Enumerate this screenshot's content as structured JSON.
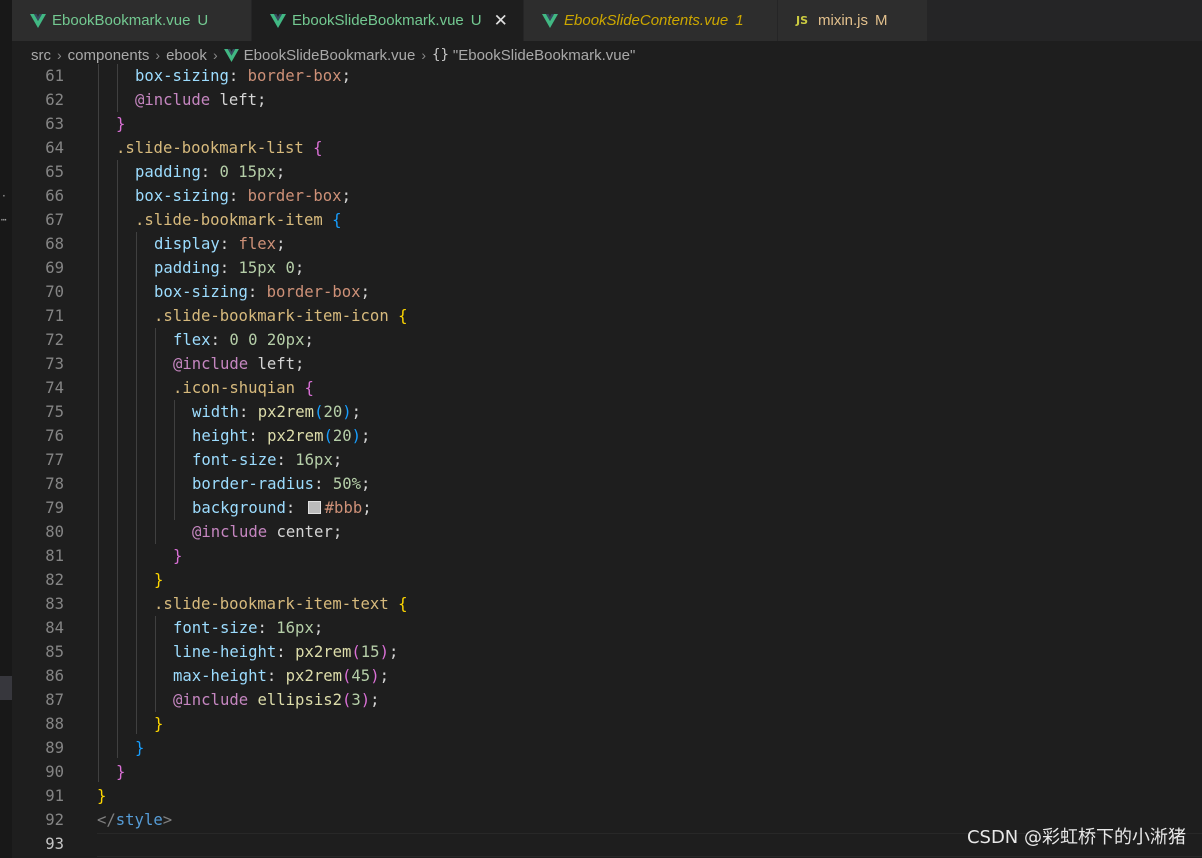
{
  "tabs": [
    {
      "name": "EbookBookmark.vue",
      "badge": "U",
      "icon": "vue-icon",
      "active": false,
      "italic": false,
      "color": "#73c991"
    },
    {
      "name": "EbookSlideBookmark.vue",
      "badge": "U",
      "icon": "vue-icon",
      "active": true,
      "italic": false,
      "color": "#73c991",
      "close": "✕"
    },
    {
      "name": "EbookSlideContents.vue",
      "badge": "1",
      "icon": "vue-icon",
      "active": false,
      "italic": true,
      "color": "#cca700"
    },
    {
      "name": "mixin.js",
      "badge": "M",
      "icon": "js-icon",
      "icon_text": "JS",
      "active": false,
      "italic": false,
      "color": "#e2c08d"
    }
  ],
  "breadcrumb": {
    "items": [
      "src",
      "components",
      "ebook",
      "EbookSlideBookmark.vue",
      "\"EbookSlideBookmark.vue\""
    ],
    "separator": "›",
    "symbol_icon": "{}"
  },
  "editor": {
    "current_line": "93",
    "lines": [
      {
        "n": "61",
        "indent": 2
      },
      {
        "n": "62",
        "indent": 2
      },
      {
        "n": "63",
        "indent": 1
      },
      {
        "n": "64",
        "indent": 1
      },
      {
        "n": "65",
        "indent": 2
      },
      {
        "n": "66",
        "indent": 2
      },
      {
        "n": "67",
        "indent": 2
      },
      {
        "n": "68",
        "indent": 3
      },
      {
        "n": "69",
        "indent": 3
      },
      {
        "n": "70",
        "indent": 3
      },
      {
        "n": "71",
        "indent": 3
      },
      {
        "n": "72",
        "indent": 4
      },
      {
        "n": "73",
        "indent": 4
      },
      {
        "n": "74",
        "indent": 4
      },
      {
        "n": "75",
        "indent": 5
      },
      {
        "n": "76",
        "indent": 5
      },
      {
        "n": "77",
        "indent": 5
      },
      {
        "n": "78",
        "indent": 5
      },
      {
        "n": "79",
        "indent": 5
      },
      {
        "n": "80",
        "indent": 5
      },
      {
        "n": "81",
        "indent": 4
      },
      {
        "n": "82",
        "indent": 3
      },
      {
        "n": "83",
        "indent": 3
      },
      {
        "n": "84",
        "indent": 4
      },
      {
        "n": "85",
        "indent": 4
      },
      {
        "n": "86",
        "indent": 4
      },
      {
        "n": "87",
        "indent": 4
      },
      {
        "n": "88",
        "indent": 3
      },
      {
        "n": "89",
        "indent": 2
      },
      {
        "n": "90",
        "indent": 1
      },
      {
        "n": "91",
        "indent": 0
      },
      {
        "n": "92",
        "indent": 0
      },
      {
        "n": "93",
        "indent": 0
      }
    ],
    "code": {
      "l61": [
        "box-sizing",
        ": ",
        "border-box",
        ";"
      ],
      "l62": [
        "@include",
        " left;"
      ],
      "l63": [
        "}"
      ],
      "l64": [
        ".slide-bookmark-list",
        " ",
        "{"
      ],
      "l65": [
        "padding",
        ": ",
        "0",
        " ",
        "15px",
        ";"
      ],
      "l66": [
        "box-sizing",
        ": ",
        "border-box",
        ";"
      ],
      "l67": [
        ".slide-bookmark-item",
        " ",
        "{"
      ],
      "l68": [
        "display",
        ": ",
        "flex",
        ";"
      ],
      "l69": [
        "padding",
        ": ",
        "15px",
        " ",
        "0",
        ";"
      ],
      "l70": [
        "box-sizing",
        ": ",
        "border-box",
        ";"
      ],
      "l71": [
        ".slide-bookmark-item-icon",
        " ",
        "{"
      ],
      "l72": [
        "flex",
        ": ",
        "0",
        " ",
        "0",
        " ",
        "20px",
        ";"
      ],
      "l73": [
        "@include",
        " left;"
      ],
      "l74": [
        ".icon-shuqian",
        " ",
        "{"
      ],
      "l75": [
        "width",
        ": ",
        "px2rem",
        "(",
        "20",
        ")",
        ";"
      ],
      "l76": [
        "height",
        ": ",
        "px2rem",
        "(",
        "20",
        ")",
        ";"
      ],
      "l77": [
        "font-size",
        ": ",
        "16px",
        ";"
      ],
      "l78": [
        "border-radius",
        ": ",
        "50%",
        ";"
      ],
      "l79": [
        "background",
        ": ",
        "#bbb",
        ";"
      ],
      "l80": [
        "@include",
        " center;"
      ],
      "l81": [
        "}"
      ],
      "l82": [
        "}"
      ],
      "l83": [
        ".slide-bookmark-item-text",
        " ",
        "{"
      ],
      "l84": [
        "font-size",
        ": ",
        "16px",
        ";"
      ],
      "l85": [
        "line-height",
        ": ",
        "px2rem",
        "(",
        "15",
        ")",
        ";"
      ],
      "l86": [
        "max-height",
        ": ",
        "px2rem",
        "(",
        "45",
        ")",
        ";"
      ],
      "l87": [
        "@include",
        " ",
        "ellipsis2",
        "(",
        "3",
        ")",
        ";"
      ],
      "l88": [
        "}"
      ],
      "l89": [
        "}"
      ],
      "l90": [
        "}"
      ],
      "l91": [
        "}"
      ],
      "l92": [
        "</",
        "style",
        ">"
      ],
      "l93": [
        ""
      ]
    },
    "swatch_color": "#bbbbbb"
  },
  "watermark": "CSDN @彩虹桥下的小淅猪",
  "colors": {
    "background": "#1e1e1e",
    "property": "#9cdcfe",
    "value": "#ce9178",
    "number": "#b5cea8",
    "at_rule": "#c586c0",
    "selector": "#d7ba7d",
    "function": "#dcdcaa",
    "bracket_1": "#ffd700",
    "bracket_2": "#da70d6",
    "bracket_3": "#179fff"
  }
}
